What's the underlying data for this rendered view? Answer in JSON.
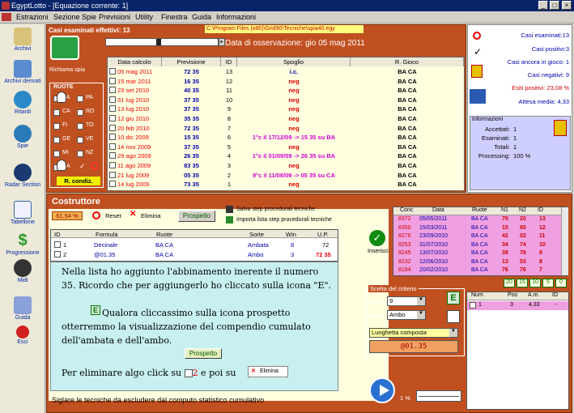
{
  "window": {
    "title": "EgyptLotto - [Equazione corrente: 1]"
  },
  "menu": [
    "Estrazioni",
    "Sezione Spie",
    "Previsioni",
    "Utility",
    "Finestra",
    "Guida",
    "Informazioni"
  ],
  "sidebar": {
    "archivi": "Archivi",
    "archivi_derivati": "Archivi derivati",
    "ritardi": "Ritardi",
    "spie": "Spie",
    "radar": "Radar Section",
    "tabellone": "Tabellone",
    "progressione": "Progressione",
    "midi": "Midi",
    "guida": "Guida",
    "esci": "Esci"
  },
  "top": {
    "casi_label": "Casi esaminati effettivi: 13",
    "path": "C:\\Program Files (x86)\\Grid90\\Tecniche\\spia40.egy",
    "data_oss": "Data di osservazione:  gio 05 mag 2011",
    "richiama": "Richiama spia",
    "ruote_title": "RUOTE",
    "ruote": [
      "BA",
      "CA",
      "FI",
      "GE",
      "MI",
      "NA",
      "PA",
      "RO",
      "TO",
      "VE",
      "NZ"
    ],
    "r_condiz": "R. condiz.",
    "headers": [
      "Data calcolo",
      "Previsione",
      "ID",
      "Spoglio",
      "R. Gioco"
    ],
    "rows": [
      [
        "05 mag 2011",
        "72 35",
        "13",
        "i.c.",
        "BA CA"
      ],
      [
        "15 mar 2011",
        "16 35",
        "12",
        "neg",
        "BA CA"
      ],
      [
        "23 set 2010",
        "40 35",
        "11",
        "neg",
        "BA CA"
      ],
      [
        "31 lug 2010",
        "37 35",
        "10",
        "neg",
        "BA CA"
      ],
      [
        "13 lug 2010",
        "37 35",
        "9",
        "neg",
        "BA CA"
      ],
      [
        "12 giu 2010",
        "35 35",
        "8",
        "neg",
        "BA CA"
      ],
      [
        "20 feb 2010",
        "72 35",
        "7",
        "neg",
        "BA CA"
      ],
      [
        "10 dic 2009",
        "15 35",
        "6",
        "1°c il 17/12/09 -> 15 35 su BA",
        "BA CA"
      ],
      [
        "14 nov 2009",
        "37 35",
        "5",
        "neg",
        "BA CA"
      ],
      [
        "29 ago 2009",
        "26 35",
        "4",
        "1°c il 01/09/09 -> 26 35 su BA",
        "BA CA"
      ],
      [
        "11 ago 2009",
        "83 35",
        "3",
        "neg",
        "BA CA"
      ],
      [
        "21 lug 2009",
        "05 35",
        "2",
        "9°c il 11/08/09 -> 05 35 su CA",
        "BA CA"
      ],
      [
        "14 lug 2009",
        "73 35",
        "1",
        "neg",
        "BA CA"
      ]
    ]
  },
  "stats": {
    "casi_esaminati": "Casi esaminati:13",
    "casi_positivi": "Casi positivi:3",
    "casi_gioco": "Casi ancora in gioco: 1",
    "casi_negativi": "Casi negativi: 9",
    "esiti": "Esiti positivi: 23,08 %",
    "attesa": "Attesa media: 4,33"
  },
  "info": {
    "title": "Informazioni",
    "accettati": "Accettati:",
    "accettati_v": "1",
    "esaminati": "Esaminati:",
    "esaminati_v": "1",
    "totali": "Totali:",
    "totali_v": "1",
    "processing": "Processing:",
    "processing_v": "100 %"
  },
  "costr": {
    "title": "Costruttore",
    "pct": "61,54 %",
    "reset": "Reset",
    "elimina": "Elimina",
    "prospetto": "Prospetto",
    "salva": "Salva step procedurali tecniche",
    "importa": "Importa lista step procedurali tecniche",
    "headers": [
      "ID",
      "Formula",
      "Ruote",
      "Sorte",
      "Win",
      "U.P."
    ],
    "rows": [
      [
        "1",
        "Decinale",
        "BA CA",
        "Ambata",
        "8",
        "72"
      ],
      [
        "2",
        "@01.35",
        "BA CA",
        "Ambo",
        "3",
        "72 35"
      ]
    ],
    "note1": "Nella lista ho aggiunto l'abbinamento inerente il numero 35. Ricordo che per aggiungerlo ho cliccato sulla icona \"E\".",
    "note2": "Qualora cliccassimo sulla icona prospetto otterremmo la visualizzazione del compendio cumulato dell'ambata e dell'ambo.",
    "note_prosp": "Prospetto",
    "note3a": "Per eliminare algo click su ",
    "note3b": "2",
    "note3c": " e poi su ",
    "note3d": "Elimina",
    "footer": "Siglare le tecniche da escludere dal computo statistico cumulativo",
    "inserisci": "Inserisci"
  },
  "conc": {
    "headers": [
      "Conc",
      "Data",
      "Ruote",
      "N1",
      "N2",
      "ID"
    ],
    "rows": [
      [
        "8372",
        "05/05/2011",
        "BA CA",
        "70",
        "20",
        "13"
      ],
      [
        "8350",
        "15/03/2011",
        "BA CA",
        "15",
        "65",
        "12"
      ],
      [
        "8276",
        "23/09/2010",
        "BA CA",
        "42",
        "02",
        "11"
      ],
      [
        "8253",
        "31/07/2010",
        "BA CA",
        "34",
        "74",
        "10"
      ],
      [
        "8245",
        "13/07/2010",
        "BA CA",
        "38",
        "78",
        "9"
      ],
      [
        "8232",
        "12/06/2010",
        "BA CA",
        "13",
        "53",
        "8"
      ],
      [
        "8184",
        "20/02/2010",
        "BA CA",
        "76",
        "76",
        "7"
      ]
    ],
    "counts": [
      "20",
      "15",
      "10",
      "5",
      "0"
    ]
  },
  "criterio": {
    "title": "Scelta del criterio",
    "colpi_label": "Colpi:",
    "colpi": "9",
    "sorte_label": "Sorte:",
    "sorte": "Ambo",
    "lunghetta": "Lunghetta composta",
    "formula": "@01.35",
    "e": "E"
  },
  "num": {
    "headers": [
      "Num",
      "Pos",
      "A.m.",
      "ID"
    ],
    "row": [
      "1",
      "3",
      "4,33",
      "-"
    ]
  },
  "pct_low": "1 %",
  "colors": {
    "panel": "#c05020",
    "pink": "#f0a0e0",
    "cyan": "#c8f0f0"
  }
}
